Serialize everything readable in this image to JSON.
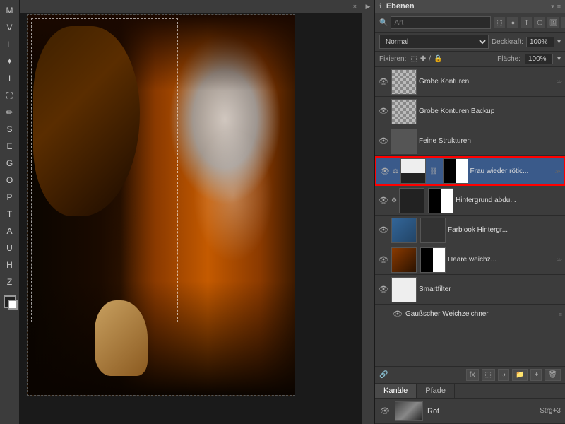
{
  "window": {
    "title": "Ebenen",
    "close_label": "×",
    "minimize_label": "−"
  },
  "toolbar": {
    "tools": [
      "M",
      "V",
      "L",
      "W",
      "E",
      "S",
      "B",
      "T",
      "P",
      "G",
      "H"
    ]
  },
  "panel": {
    "title": "Ebenen",
    "search_placeholder": "Art",
    "blend_mode": "Normal",
    "opacity_label": "Deckkraft:",
    "opacity_value": "100%",
    "fixieren_label": "Fixieren:",
    "flaeche_label": "Fläche:",
    "flaeche_value": "100%"
  },
  "layers": [
    {
      "id": "layer-1",
      "name": "Grobe Konturen",
      "visible": true,
      "thumb_type": "checker",
      "has_mask": false,
      "selected": false
    },
    {
      "id": "layer-2",
      "name": "Grobe Konturen Backup",
      "visible": true,
      "thumb_type": "checker",
      "has_mask": false,
      "selected": false
    },
    {
      "id": "layer-3",
      "name": "Feine Strukturen",
      "visible": true,
      "thumb_type": "dark",
      "has_mask": false,
      "selected": false
    },
    {
      "id": "layer-4",
      "name": "Frau wieder rötic...",
      "visible": true,
      "thumb_type": "white_bw",
      "has_mask": true,
      "selected": true,
      "red_outline": true,
      "has_link": true,
      "has_extra": true
    },
    {
      "id": "layer-5",
      "name": "Hintergrund abdu...",
      "visible": true,
      "thumb_type": "black",
      "has_mask": true,
      "selected": false,
      "has_extra": true
    },
    {
      "id": "layer-6",
      "name": "Farblook Hintergr...",
      "visible": true,
      "thumb_type": "blue",
      "has_mask": true,
      "selected": false
    },
    {
      "id": "layer-7",
      "name": "Haare weichz...",
      "visible": true,
      "thumb_type": "photo",
      "has_mask": true,
      "selected": false
    },
    {
      "id": "layer-8",
      "name": "Smartfilter",
      "visible": true,
      "thumb_type": "white",
      "has_mask": false,
      "selected": false,
      "is_smartfilter": true
    },
    {
      "id": "layer-9",
      "name": "Gaußscher Weichzeichner",
      "visible": true,
      "thumb_type": "none",
      "has_mask": false,
      "selected": false,
      "is_filter": true
    }
  ],
  "tabs": {
    "items": [
      "Kanäle",
      "Pfade"
    ],
    "active": "Kanäle"
  },
  "channels": [
    {
      "name": "Rot",
      "shortcut": "Strg+3",
      "thumb_type": "photo_bw"
    }
  ],
  "bottom_bar": {
    "buttons": [
      "fx",
      "⊕",
      "🗑"
    ]
  }
}
